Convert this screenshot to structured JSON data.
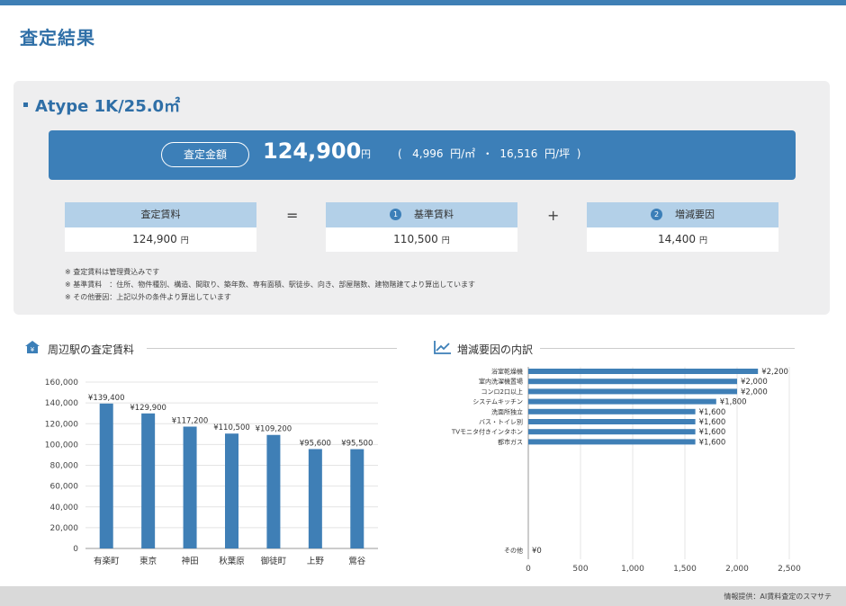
{
  "page": {
    "title": "査定結果"
  },
  "property": {
    "type_title": "Atype 1K/25.0㎡",
    "assessment_label": "査定金額",
    "assessment_price": "124,900",
    "price_unit": "円",
    "sub_info": "(   4,996  円/㎡  ・  16,516  円/坪  )"
  },
  "formula": {
    "rent_label": "査定賃料",
    "rent_value": "124,900",
    "rent_unit": "円",
    "equals": "=",
    "base_num": "1",
    "base_label": "基準賃料",
    "base_value": "110,500",
    "base_unit": "円",
    "plus": "+",
    "adjust_num": "2",
    "adjust_label": "増減要因",
    "adjust_value": "14,400",
    "adjust_unit": "円"
  },
  "notes": [
    "※ 査定賃料は管理費込みです",
    "※ 基準賃料　：住所、物件種別、構造、間取り、築年数、専有面積、駅徒歩、向き、部屋階数、建物階建てより算出しています",
    "※ その他要因：上記以外の条件より算出しています"
  ],
  "station_section": {
    "title": "周辺駅の査定賃料"
  },
  "factor_section": {
    "title": "増減要因の内訳"
  },
  "colors": {
    "accent": "#3c7fb8",
    "bar": "#3f7fb6",
    "light": "#b3d0e8"
  },
  "chart_data": [
    {
      "type": "bar",
      "categories": [
        "有楽町",
        "東京",
        "神田",
        "秋葉原",
        "御徒町",
        "上野",
        "鶯谷"
      ],
      "values": [
        139400,
        129900,
        117200,
        110500,
        109200,
        95600,
        95500
      ],
      "data_labels": [
        "¥139,400",
        "¥129,900",
        "¥117,200",
        "¥110,500",
        "¥109,200",
        "¥95,600",
        "¥95,500"
      ],
      "yticks": [
        "0",
        "20,000",
        "40,000",
        "60,000",
        "80,000",
        "100,000",
        "120,000",
        "140,000",
        "160,000"
      ],
      "ylim": [
        0,
        160000
      ],
      "grid": true
    },
    {
      "type": "bar",
      "orientation": "horizontal",
      "categories": [
        "浴室乾燥機",
        "室内洗濯機置場",
        "コンロ2口以上",
        "システムキッチン",
        "洗面所独立",
        "バス・トイレ別",
        "TVモニタ付きインタホン",
        "都市ガス",
        "その他"
      ],
      "values": [
        2200,
        2000,
        2000,
        1800,
        1600,
        1600,
        1600,
        1600,
        0
      ],
      "data_labels": [
        "¥2,200",
        "¥2,000",
        "¥2,000",
        "¥1,800",
        "¥1,600",
        "¥1,600",
        "¥1,600",
        "¥1,600",
        "¥0"
      ],
      "xticks": [
        "0",
        "500",
        "1,000",
        "1,500",
        "2,000",
        "2,500"
      ],
      "xlim": [
        0,
        2500
      ],
      "grid": true
    }
  ],
  "footer": {
    "credit": "情報提供：AI賃料査定のスマサテ"
  }
}
